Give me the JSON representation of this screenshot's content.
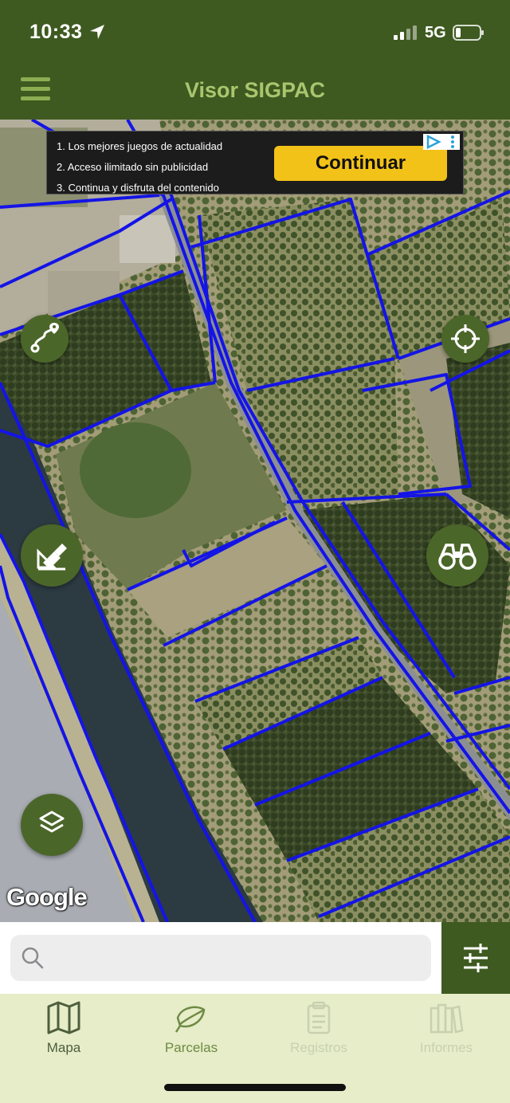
{
  "status_bar": {
    "time": "10:33",
    "network": "5G"
  },
  "header": {
    "title": "Visor SIGPAC"
  },
  "ad": {
    "lines": [
      "1. Los mejores juegos de actualidad",
      "2. Acceso ilimitado sin publicidad",
      "3. Continua y disfruta del contenido"
    ],
    "button_label": "Continuar"
  },
  "map": {
    "attribution": "Google",
    "parcel_outline_color": "#1414e6"
  },
  "search": {
    "placeholder": "",
    "value": ""
  },
  "tabs": [
    {
      "label": "Mapa",
      "icon": "map-icon",
      "state": "active"
    },
    {
      "label": "Parcelas",
      "icon": "leaf-icon",
      "state": "enabled"
    },
    {
      "label": "Registros",
      "icon": "clipboard-icon",
      "state": "disabled"
    },
    {
      "label": "Informes",
      "icon": "books-icon",
      "state": "disabled"
    }
  ],
  "colors": {
    "header_bg": "#3e5a20",
    "title": "#a9c66f",
    "fab_bg": "#4b6629",
    "tabbar_bg": "#e6edc8",
    "tab_active": "#4e5e3e",
    "tab_enabled": "#6f8a45",
    "tab_disabled": "#c8d0b0",
    "ad_button": "#f2c218"
  }
}
